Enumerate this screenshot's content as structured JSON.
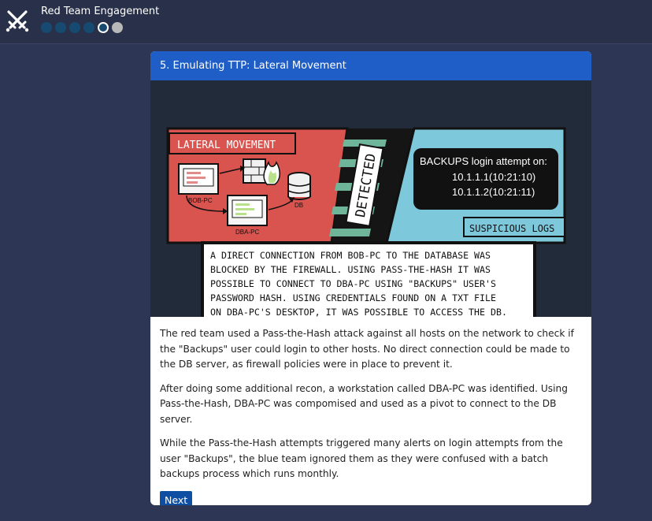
{
  "app": {
    "title": "Red Team Engagement",
    "progress": {
      "total_steps": 6,
      "current_step": 5
    }
  },
  "card": {
    "title": "5. Emulating TTP: Lateral Movement",
    "illustration": {
      "banner_left": "LATERAL MOVEMENT",
      "banner_right": "SUSPICIOUS LOGS",
      "stamp": "DETECTED",
      "nodes": {
        "pc1": "BOB-PC",
        "pc2": "DBA-PC",
        "db": "DB"
      },
      "log_title": "BACKUPS login attempt on:",
      "log_lines": [
        "10.1.1.1(10:21:10)",
        "10.1.1.2(10:21:11)"
      ],
      "caption_lines": [
        "A DIRECT CONNECTION FROM BOB-PC TO THE DATABASE WAS",
        "BLOCKED BY THE FIREWALL. USING PASS-THE-HASH IT WAS",
        "POSSIBLE TO CONNECT TO DBA-PC USING \"BACKUPS\" USER'S",
        "PASSWORD HASH. USING CREDENTIALS FOUND ON A TXT FILE",
        "ON DBA-PC'S DESKTOP, IT WAS POSSIBLE TO ACCESS THE DB."
      ]
    },
    "paragraphs": [
      "The red team used a Pass-the-Hash attack against all hosts on the network to check if the \"Backups\" user could login to other hosts. No direct connection could be made to the DB server, as firewall policies were in place to prevent it.",
      "After doing some additional recon, a workstation called DBA-PC was identified. Using Pass-the-Hash, DBA-PC was compomised and used as a pivot to connect to the DB server.",
      "While the Pass-the-Hash attempts triggered many alerts on login attempts from the user \"Backups\", the blue team ignored them as they were confused with a batch backups process which runs monthly."
    ],
    "next_label": "Next"
  },
  "colors": {
    "background": "#2d3654",
    "header": "#1f5ec7",
    "button": "#0f4fa3",
    "progress_done": "#174a70",
    "progress_todo": "#b8b8b8",
    "panel_red": "#d9534f",
    "panel_blue": "#7ec8dc"
  }
}
